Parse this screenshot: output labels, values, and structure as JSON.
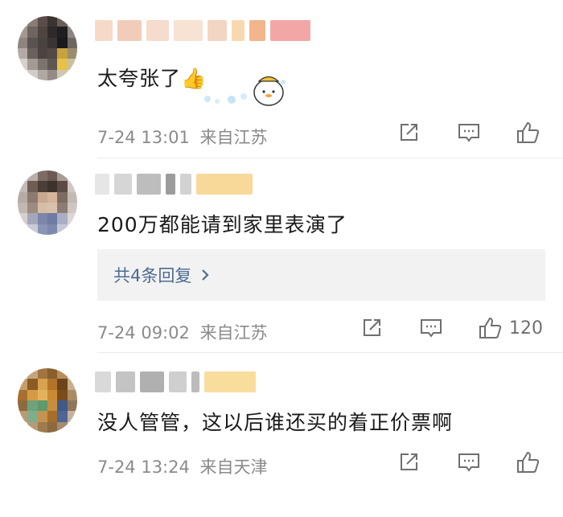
{
  "comments": [
    {
      "text": "太夸张了👍",
      "date": "7-24 13:01",
      "location": "来自江苏",
      "like_count": ""
    },
    {
      "text": "200万都能请到家里表演了",
      "date": "7-24 09:02",
      "location": "来自江苏",
      "like_count": "120",
      "replies_label": "共4条回复",
      "replies_chevron": "›"
    },
    {
      "text": "没人管管，这以后谁还买的着正价票啊",
      "date": "7-24 13:24",
      "location": "来自天津",
      "like_count": ""
    }
  ],
  "icons": [
    "share-icon",
    "comment-icon",
    "like-icon",
    "chevron-right-icon"
  ],
  "colors": {
    "meta_text": "#8a8a8a",
    "reply_link": "#4d6b91",
    "reply_bg": "#f2f2f2",
    "icon": "#6f6f6f"
  }
}
